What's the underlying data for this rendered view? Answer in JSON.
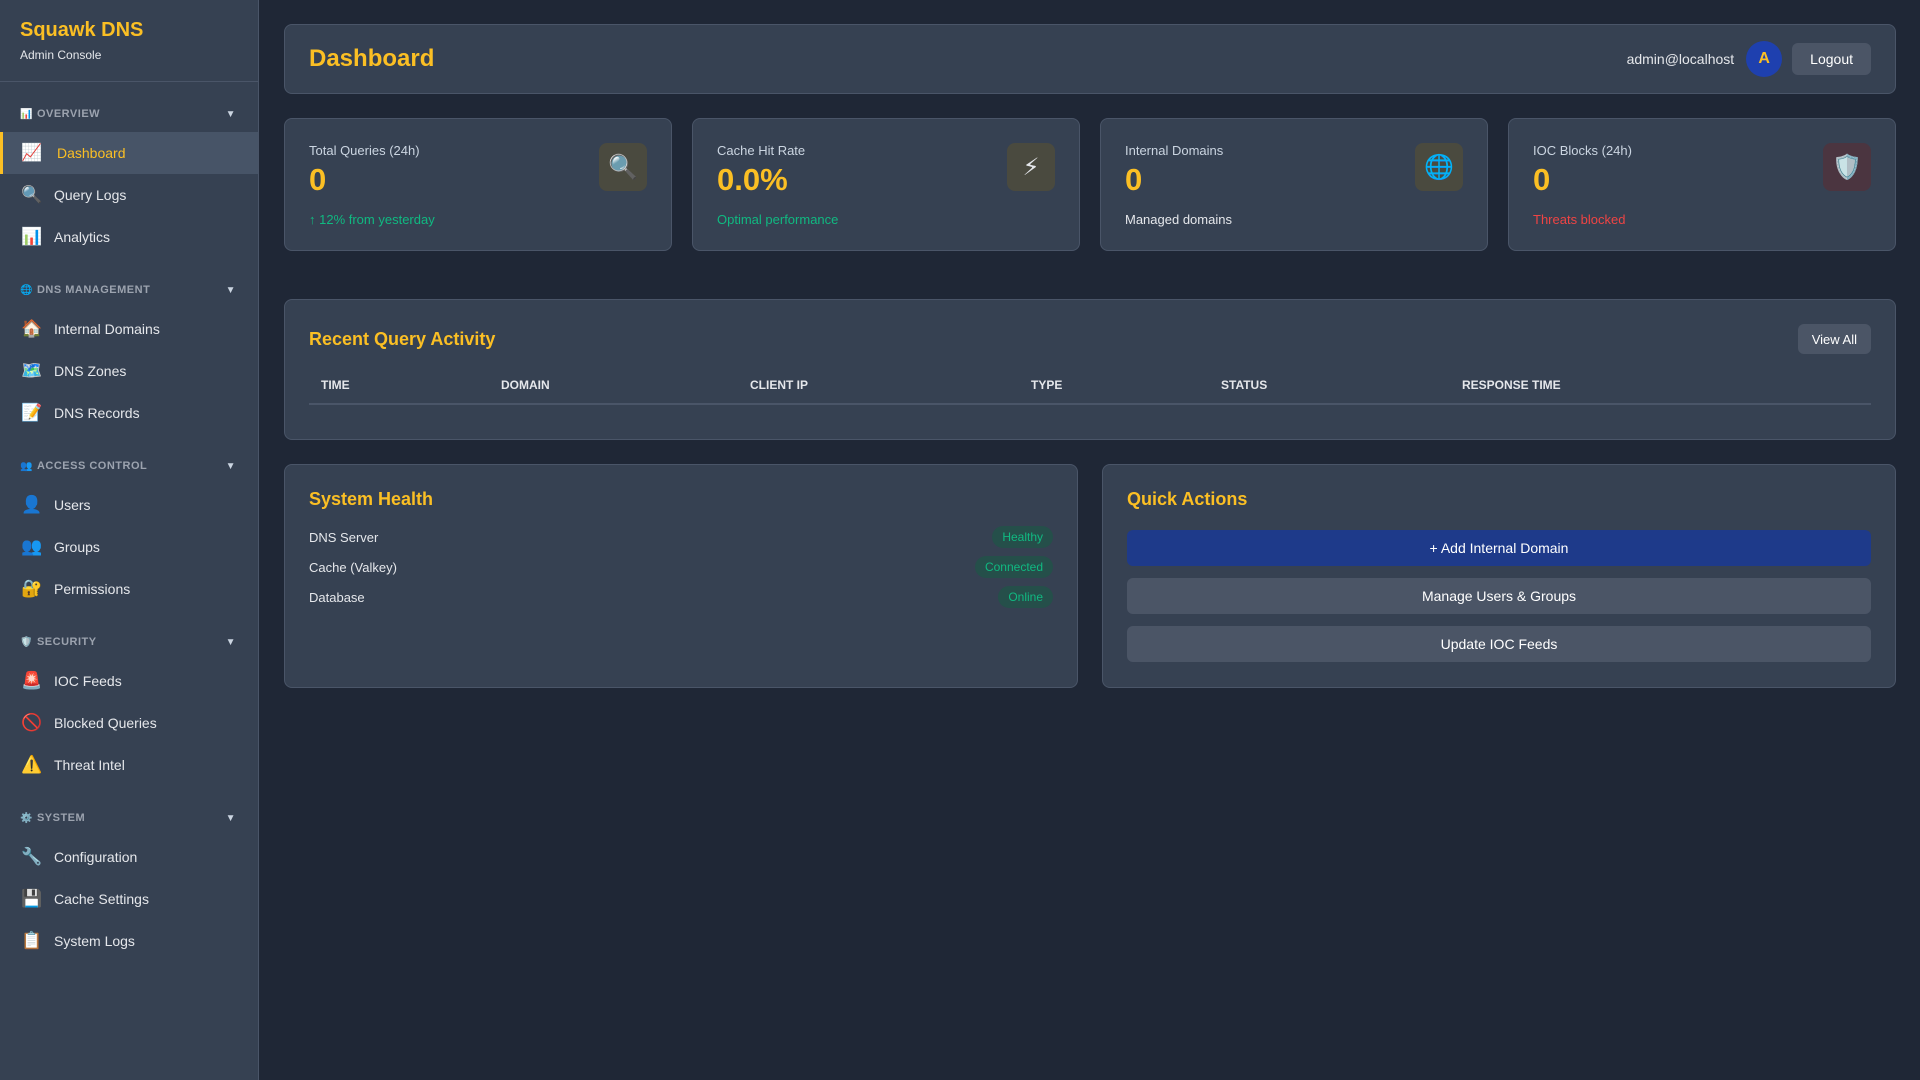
{
  "brand": {
    "title": "Squawk DNS",
    "subtitle": "Admin Console"
  },
  "sidebar": {
    "sections": [
      {
        "title": "OVERVIEW",
        "icon": "📊",
        "items": [
          {
            "label": "Dashboard",
            "icon": "📈",
            "active": true
          },
          {
            "label": "Query Logs",
            "icon": "🔍"
          },
          {
            "label": "Analytics",
            "icon": "📊"
          }
        ]
      },
      {
        "title": "DNS MANAGEMENT",
        "icon": "🌐",
        "items": [
          {
            "label": "Internal Domains",
            "icon": "🏠"
          },
          {
            "label": "DNS Zones",
            "icon": "🗺️"
          },
          {
            "label": "DNS Records",
            "icon": "📝"
          }
        ]
      },
      {
        "title": "ACCESS CONTROL",
        "icon": "👥",
        "items": [
          {
            "label": "Users",
            "icon": "👤"
          },
          {
            "label": "Groups",
            "icon": "👥"
          },
          {
            "label": "Permissions",
            "icon": "🔐"
          }
        ]
      },
      {
        "title": "SECURITY",
        "icon": "🛡️",
        "items": [
          {
            "label": "IOC Feeds",
            "icon": "🚨"
          },
          {
            "label": "Blocked Queries",
            "icon": "🚫"
          },
          {
            "label": "Threat Intel",
            "icon": "⚠️"
          }
        ]
      },
      {
        "title": "SYSTEM",
        "icon": "⚙️",
        "items": [
          {
            "label": "Configuration",
            "icon": "🔧"
          },
          {
            "label": "Cache Settings",
            "icon": "💾"
          },
          {
            "label": "System Logs",
            "icon": "📋"
          }
        ]
      }
    ],
    "chevron": "▼"
  },
  "header": {
    "title": "Dashboard",
    "user_email": "admin@localhost",
    "avatar_initial": "A",
    "logout_label": "Logout"
  },
  "stats": [
    {
      "label": "Total Queries (24h)",
      "value": "0",
      "note": "↑ 12% from yesterday",
      "icon": "🔍"
    },
    {
      "label": "Cache Hit Rate",
      "value": "0.0%",
      "note": "Optimal performance",
      "icon": "⚡"
    },
    {
      "label": "Internal Domains",
      "value": "0",
      "note": "Managed domains",
      "icon": "🌐"
    },
    {
      "label": "IOC Blocks (24h)",
      "value": "0",
      "note": "Threats blocked",
      "icon": "🛡️"
    }
  ],
  "activity": {
    "title": "Recent Query Activity",
    "view_all_label": "View All",
    "columns": [
      "TIME",
      "DOMAIN",
      "CLIENT IP",
      "TYPE",
      "STATUS",
      "RESPONSE TIME"
    ]
  },
  "health": {
    "title": "System Health",
    "rows": [
      {
        "label": "DNS Server",
        "status": "Healthy"
      },
      {
        "label": "Cache (Valkey)",
        "status": "Connected"
      },
      {
        "label": "Database",
        "status": "Online"
      }
    ]
  },
  "quick_actions": {
    "title": "Quick Actions",
    "buttons": [
      "+ Add Internal Domain",
      "Manage Users & Groups",
      "Update IOC Feeds"
    ]
  },
  "colors": {
    "accent": "#fbbf24",
    "success": "#10b981",
    "danger": "#ef4444",
    "primary_button": "#1e3a8a"
  }
}
